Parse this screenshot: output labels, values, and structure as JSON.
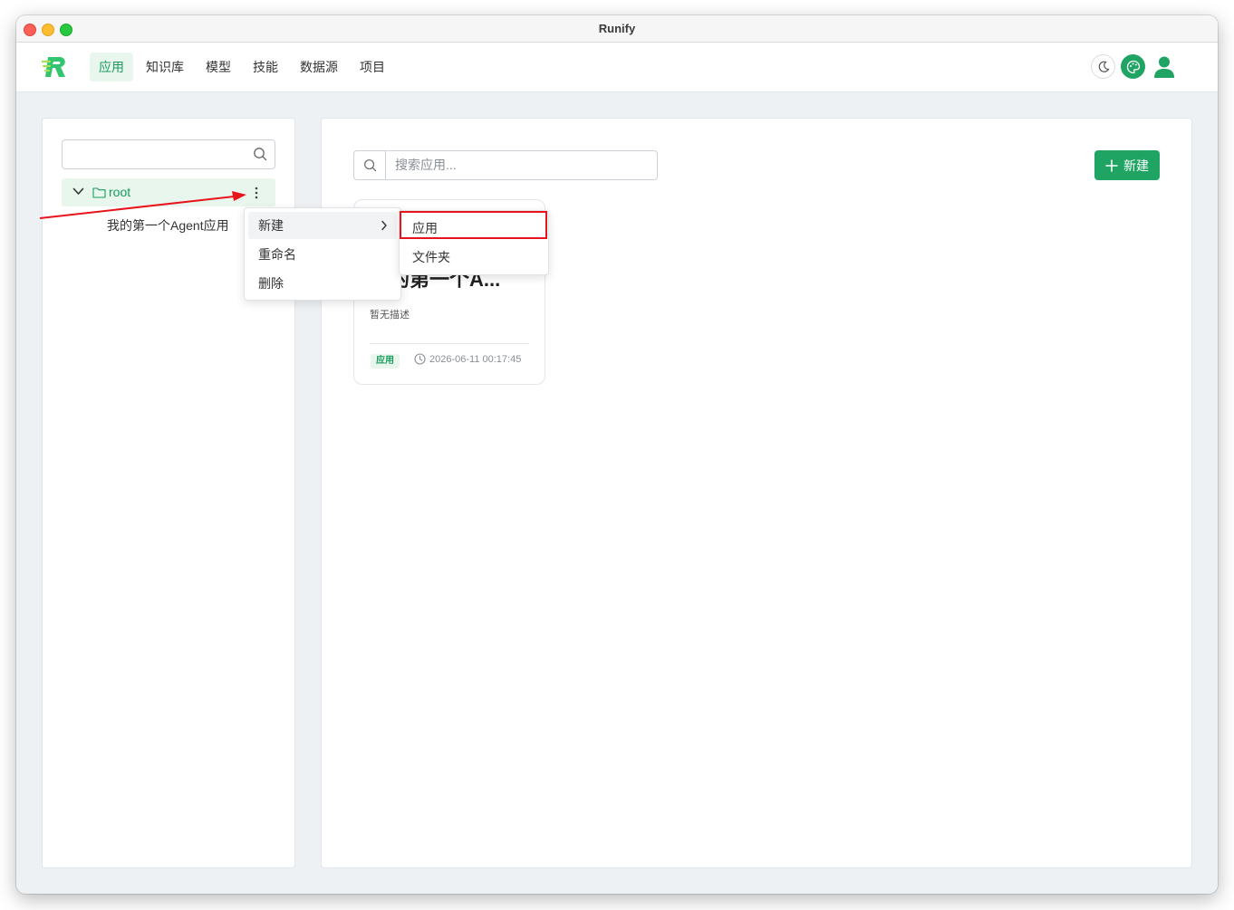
{
  "window": {
    "title": "Runify"
  },
  "nav": {
    "items": [
      {
        "label": "应用",
        "active": true
      },
      {
        "label": "知识库"
      },
      {
        "label": "模型"
      },
      {
        "label": "技能"
      },
      {
        "label": "数据源"
      },
      {
        "label": "项目"
      }
    ]
  },
  "sidebar": {
    "search_value": "",
    "tree": {
      "root_label": "root",
      "children": [
        "我的第一个Agent应用"
      ]
    }
  },
  "context_menu": {
    "items": [
      {
        "label": "新建",
        "has_submenu": true
      },
      {
        "label": "重命名"
      },
      {
        "label": "删除"
      }
    ],
    "submenu": [
      {
        "label": "应用",
        "highlighted": true
      },
      {
        "label": "文件夹"
      }
    ]
  },
  "main": {
    "search_placeholder": "搜索应用...",
    "new_button_label": "新建",
    "cards": [
      {
        "title": "我的第一个A...",
        "description": "暂无描述",
        "tag": "应用",
        "timestamp": "2026-06-11 00:17:45"
      }
    ]
  },
  "colors": {
    "accent": "#1fa463",
    "accent_light": "#e8f6ee",
    "annotation_red": "#e8141c"
  }
}
